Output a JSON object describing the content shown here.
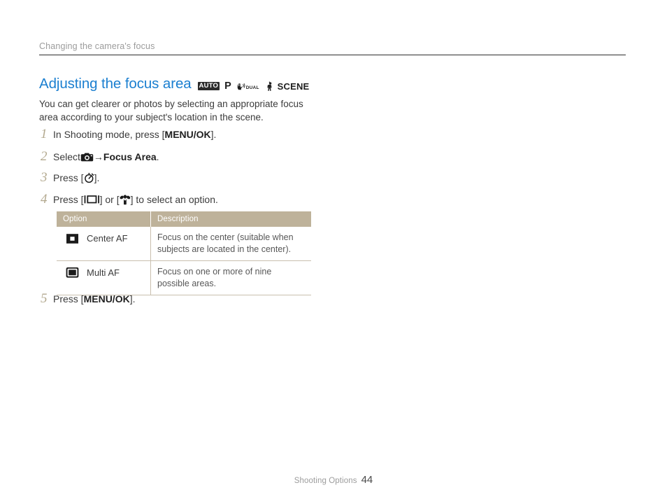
{
  "header": {
    "running_title": "Changing the camera's focus"
  },
  "section": {
    "title": "Adjusting the focus area",
    "modes": {
      "auto": "AUTO",
      "program": "P",
      "dual": "DUAL",
      "dual_icon": "dual-is-hand-icon",
      "scene_icon": "scene-person-icon",
      "scene": "SCENE"
    }
  },
  "intro": "You can get clearer or photos by selecting an appropriate focus area according to your subject's location in the scene.",
  "steps": [
    {
      "number": "1",
      "pre": "In Shooting mode, press [",
      "bold": "MENU/OK",
      "post": "]."
    },
    {
      "number": "2",
      "pre": "Select ",
      "icon": "camera-icon",
      "mid": " → ",
      "bold": "Focus Area",
      "post": "."
    },
    {
      "number": "3",
      "pre": "Press [",
      "icon": "self-timer-icon",
      "post": "]."
    },
    {
      "number": "4",
      "pre": "Press [",
      "icon": "display-button-icon",
      "mid": "] or [",
      "icon2": "macro-flower-icon",
      "post": "] to select an option."
    },
    {
      "number": "5",
      "pre": "Press [",
      "bold": "MENU/OK",
      "post": "]."
    }
  ],
  "table": {
    "headers": [
      "Option",
      "Description"
    ],
    "rows": [
      {
        "icon": "center-af-icon",
        "option": "Center AF",
        "description": "Focus on the center (suitable when subjects are located in the center)."
      },
      {
        "icon": "multi-af-icon",
        "option": "Multi AF",
        "description": "Focus on one or more of nine possible areas."
      }
    ]
  },
  "footer": {
    "label": "Shooting Options",
    "page": "44"
  },
  "colors": {
    "heading": "#1b7fd0",
    "table_header_bg": "#beb29a",
    "step_number": "#b3a98f",
    "body_text": "#3b3b3b",
    "muted_text": "#9c9c9c"
  }
}
